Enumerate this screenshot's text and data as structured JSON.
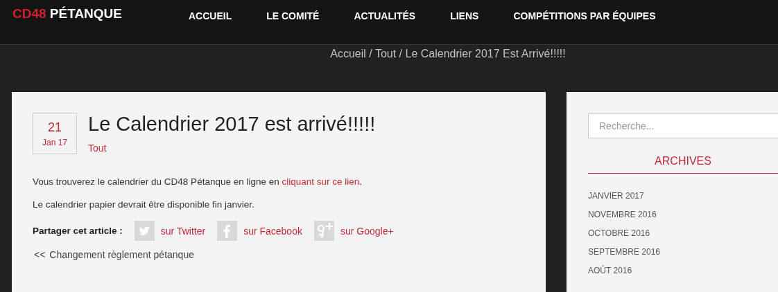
{
  "logo": {
    "accent": "CD48",
    "text": "PÉTANQUE"
  },
  "nav": [
    {
      "label": "ACCUEIL"
    },
    {
      "label": "LE COMITÉ"
    },
    {
      "label": "ACTUALITÉS"
    },
    {
      "label": "LIENS"
    },
    {
      "label": "COMPÉTITIONS PAR ÉQUIPES"
    }
  ],
  "breadcrumb": "Accueil / Tout / Le Calendrier 2017 Est Arrivé!!!!!",
  "post": {
    "day": "21",
    "month": "Jan 17",
    "title": "Le Calendrier 2017 est arrivé!!!!!",
    "category": "Tout",
    "paragraph_1": {
      "before": "Vous trouverez le calendrier du CD48 Pétanque en ligne en ",
      "link": "cliquant sur ce lien",
      "after": "."
    },
    "paragraph_2": "Le calendrier papier devrait être disponible fin janvier.",
    "share_label": "Partager cet article :",
    "share": [
      {
        "kind": "twitter",
        "label": "sur Twitter"
      },
      {
        "kind": "facebook",
        "label": "sur Facebook"
      },
      {
        "kind": "googleplus",
        "label": "sur Google+"
      }
    ],
    "previous": {
      "arrow": "<<",
      "label": "Changement règlement pétanque"
    }
  },
  "sidebar": {
    "search": {
      "placeholder": "Recherche..."
    },
    "archives_title": "ARCHIVES",
    "archives": [
      "JANVIER 2017",
      "NOVEMBRE 2016",
      "OCTOBRE 2016",
      "SEPTEMBRE 2016",
      "AOÛT 2016"
    ]
  }
}
